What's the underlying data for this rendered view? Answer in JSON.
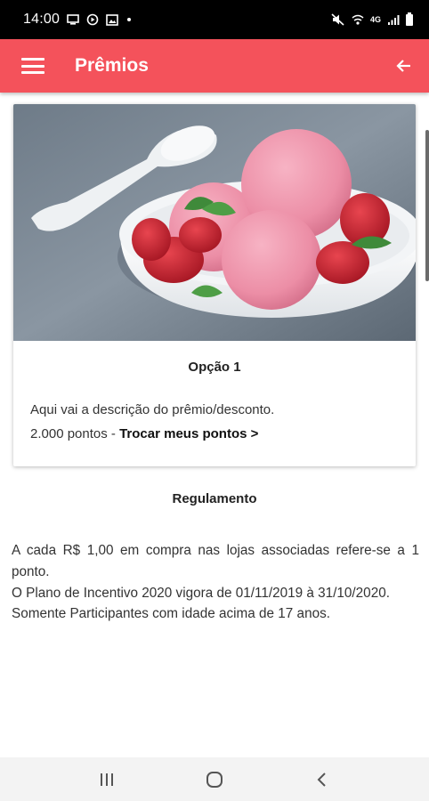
{
  "status_bar": {
    "time": "14:00",
    "network": "4G"
  },
  "app_bar": {
    "title": "Prêmios"
  },
  "reward_card": {
    "title": "Opção 1",
    "description": "Aqui vai a descrição do prêmio/desconto.",
    "points": "2.000 pontos - ",
    "trade_link": "Trocar meus pontos >"
  },
  "rules": {
    "title": "Regulamento",
    "lines": [
      "A cada R$ 1,00 em compra nas lojas associadas refere-se a 1 ponto.",
      "O Plano de Incentivo 2020 vigora de 01/11/2019 à 31/10/2020.",
      "Somente Participantes com idade acima de 17 anos."
    ]
  },
  "colors": {
    "accent": "#f4525b",
    "status_bar": "#000000",
    "nav_bar": "#f3f3f3"
  },
  "icons": {
    "menu": "menu-icon",
    "back": "arrow-back-icon",
    "nav_recents": "recents-icon",
    "nav_home": "home-icon",
    "nav_back": "nav-back-icon"
  }
}
